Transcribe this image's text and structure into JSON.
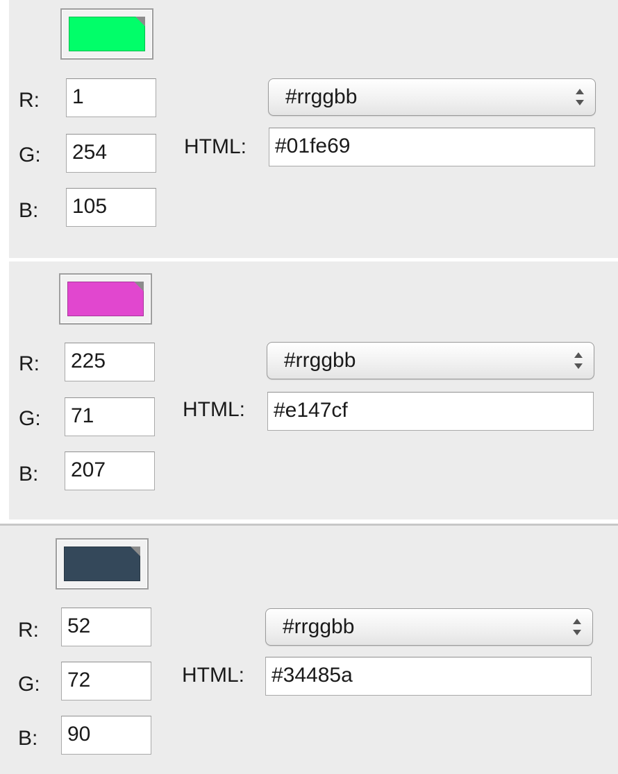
{
  "panels": [
    {
      "swatch_color": "#01fe69",
      "r_label": "R:",
      "r_value": "1",
      "g_label": "G:",
      "g_value": "254",
      "b_label": "B:",
      "b_value": "105",
      "format_selected": "#rrggbb",
      "html_label": "HTML:",
      "html_value": "#01fe69"
    },
    {
      "swatch_color": "#e147cf",
      "r_label": "R:",
      "r_value": "225",
      "g_label": "G:",
      "g_value": "71",
      "b_label": "B:",
      "b_value": "207",
      "format_selected": "#rrggbb",
      "html_label": "HTML:",
      "html_value": "#e147cf"
    },
    {
      "swatch_color": "#34485a",
      "r_label": "R:",
      "r_value": "52",
      "g_label": "G:",
      "g_value": "72",
      "b_label": "B:",
      "b_value": "90",
      "format_selected": "#rrggbb",
      "html_label": "HTML:",
      "html_value": "#34485a"
    }
  ],
  "icons": {
    "swatch_corner": "color-well-corner-icon",
    "popup_arrows": "up-down-arrows-icon"
  }
}
